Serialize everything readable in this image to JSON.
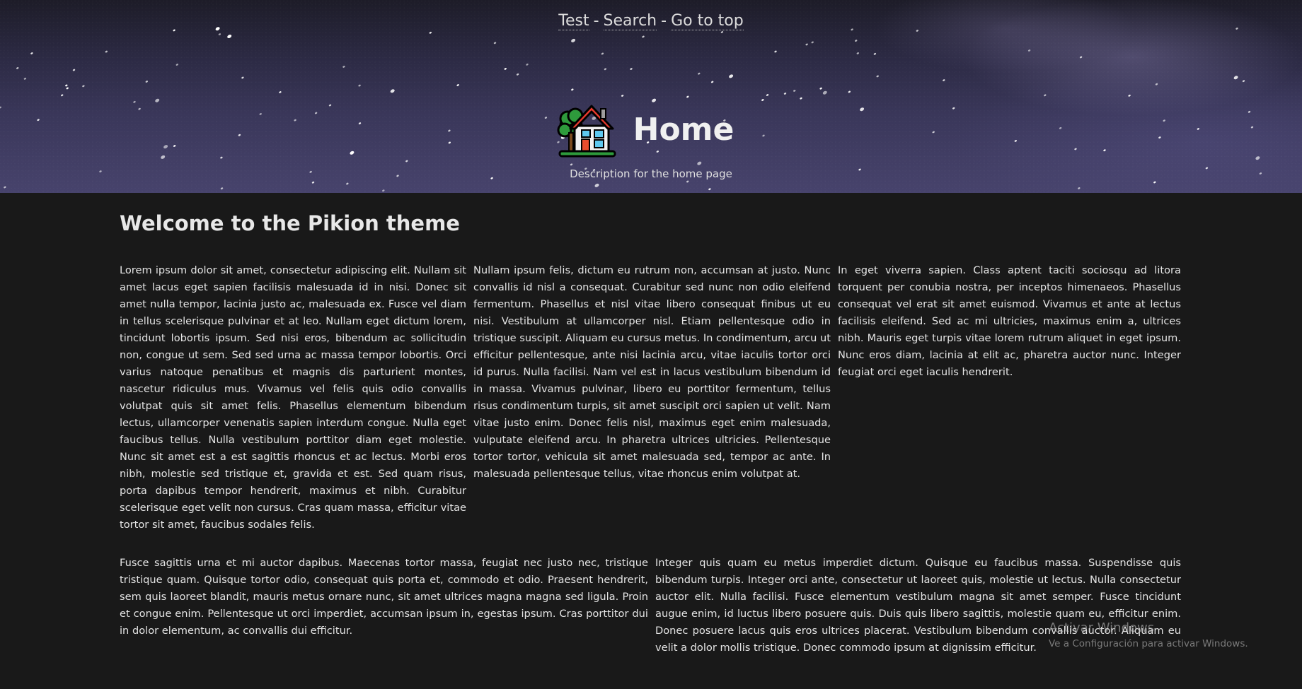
{
  "nav": {
    "links": [
      "Test",
      "Search",
      "Go to top"
    ],
    "separator": "-"
  },
  "hero": {
    "icon": "house-with-garden-emoji",
    "title": "Home",
    "description": "Description for the home page"
  },
  "main": {
    "heading": "Welcome to the Pikion theme",
    "row1": [
      "Lorem ipsum dolor sit amet, consectetur adipiscing elit. Nullam sit amet lacus eget sapien facilisis malesuada id in nisi. Donec sit amet nulla tempor, lacinia justo ac, malesuada ex. Fusce vel diam in tellus scelerisque pulvinar et at leo. Nullam eget dictum lorem, tincidunt lobortis ipsum. Sed nisi eros, bibendum ac sollicitudin non, congue ut sem. Sed sed urna ac massa tempor lobortis. Orci varius natoque penatibus et magnis dis parturient montes, nascetur ridiculus mus. Vivamus vel felis quis odio convallis volutpat quis sit amet felis. Phasellus elementum bibendum lectus, ullamcorper venenatis sapien interdum congue. Nulla eget faucibus tellus. Nulla vestibulum porttitor diam eget molestie. Nunc sit amet est a est sagittis rhoncus et ac lectus. Morbi eros nibh, molestie sed tristique et, gravida et est. Sed quam risus, porta dapibus tempor hendrerit, maximus et nibh. Curabitur scelerisque eget velit non cursus. Cras quam massa, efficitur vitae tortor sit amet, faucibus sodales felis.",
      "Nullam ipsum felis, dictum eu rutrum non, accumsan at justo. Nunc convallis id nisl a consequat. Curabitur sed nunc non odio eleifend fermentum. Phasellus et nisl vitae libero consequat finibus ut eu nisi. Vestibulum at ullamcorper nisl. Etiam pellentesque odio in tristique suscipit. Aliquam eu cursus metus. In condimentum, arcu ut efficitur pellentesque, ante nisi lacinia arcu, vitae iaculis tortor orci id purus. Nulla facilisi. Nam vel est in lacus vestibulum bibendum id in massa. Vivamus pulvinar, libero eu porttitor fermentum, tellus risus condimentum turpis, sit amet suscipit orci sapien ut velit. Nam vitae justo enim. Donec felis nisl, maximus eget enim malesuada, vulputate eleifend arcu. In pharetra ultrices ultricies. Pellentesque tortor tortor, vehicula sit amet malesuada sed, tempor ac ante. In malesuada pellentesque tellus, vitae rhoncus enim volutpat at.",
      "In eget viverra sapien. Class aptent taciti sociosqu ad litora torquent per conubia nostra, per inceptos himenaeos. Phasellus consequat vel erat sit amet euismod. Vivamus et ante at lectus facilisis eleifend. Sed ac mi ultricies, maximus enim a, ultrices nibh. Mauris eget turpis vitae lorem rutrum aliquet in eget ipsum. Nunc eros diam, lacinia at elit ac, pharetra auctor nunc. Integer feugiat orci eget iaculis hendrerit."
    ],
    "row2": [
      "Fusce sagittis urna et mi auctor dapibus. Maecenas tortor massa, feugiat nec justo nec, tristique tristique quam. Quisque tortor odio, consequat quis porta et, commodo et odio. Praesent hendrerit, sem quis laoreet blandit, mauris metus ornare nunc, sit amet ultrices magna magna sed ligula. Proin et congue enim. Pellentesque ut orci imperdiet, accumsan ipsum in, egestas ipsum. Cras porttitor dui in dolor elementum, ac convallis dui efficitur.",
      "Integer quis quam eu metus imperdiet dictum. Quisque eu faucibus massa. Suspendisse quis bibendum turpis. Integer orci ante, consectetur ut laoreet quis, molestie ut lectus. Nulla consectetur auctor elit. Nulla facilisi. Fusce elementum vestibulum magna sit amet semper. Fusce tincidunt augue enim, id luctus libero posuere quis. Duis quis libero sagittis, molestie quam eu, efficitur enim. Donec posuere lacus quis eros ultrices placerat. Vestibulum bibendum convallis auctor. Aliquam eu velit a dolor mollis tristique. Donec commodo ipsum at dignissim efficitur."
    ]
  },
  "watermark": {
    "title": "Activar Windows",
    "subtitle": "Ve a Configuración para activar Windows."
  }
}
